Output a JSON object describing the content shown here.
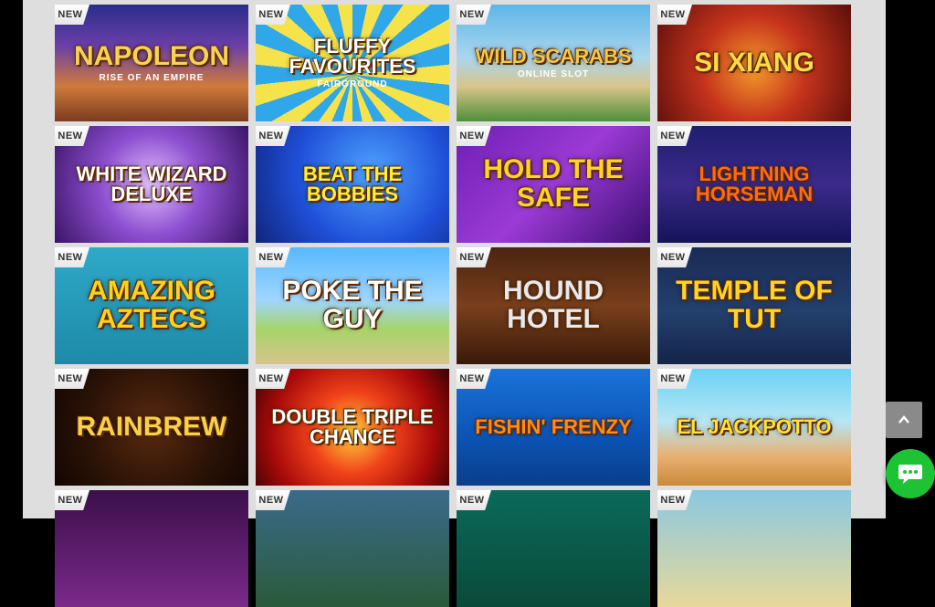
{
  "badge_label": "NEW",
  "colors": {
    "panel": "#dedede",
    "chat_button": "#1ec235",
    "scroll_button": "#8a8a8a"
  },
  "games": [
    {
      "title": "NAPOLEON",
      "subtitle": "RISE OF AN EMPIRE",
      "bg": "linear-gradient(180deg,#2a2d8a 0%,#6a3fa8 35%,#d07a3a 70%,#7a3b1f 100%)",
      "color": "#f7d255",
      "size": "big"
    },
    {
      "title": "Fluffy Favourites",
      "subtitle": "FAIRGROUND",
      "bg": "repeating-conic-gradient(from 0deg at 50% 60%, #2fa7e8 0deg 12deg, #f6e24a 12deg 24deg)",
      "color": "#ffffff",
      "size": "mid"
    },
    {
      "title": "WILD SCARABS",
      "subtitle": "ONLINE SLOT",
      "bg": "linear-gradient(180deg,#5fb5e8 0%,#a9d6ef 45%,#d9c58a 70%,#4e8f3a 100%)",
      "color": "#f2c94c",
      "size": "mid"
    },
    {
      "title": "SI XIANG",
      "subtitle": "",
      "bg": "radial-gradient(circle at 50% 55%,#f59a2b 0%,#c5331c 45%,#5a0e0a 100%)",
      "color": "#ffd94a",
      "size": "big"
    },
    {
      "title": "White Wizard Deluxe",
      "subtitle": "",
      "bg": "radial-gradient(circle at 50% 50%,#e3c2ff 0%,#8e4fd0 45%,#3a1466 100%)",
      "color": "#ffffff",
      "size": "mid"
    },
    {
      "title": "BEAT THE BOBBIES",
      "subtitle": "",
      "bg": "radial-gradient(circle at 60% 40%,#4da3ff 0%,#1f4fd8 55%,#10257a 100%)",
      "color": "#ffef3d",
      "size": "mid"
    },
    {
      "title": "HOLD THE SAFE",
      "subtitle": "",
      "bg": "linear-gradient(135deg,#6e1fb3 0%,#9c3ad6 50%,#3a0e70 100%)",
      "color": "#ffd12b",
      "size": "big"
    },
    {
      "title": "LIGHTNING HORSEMAN",
      "subtitle": "",
      "bg": "linear-gradient(180deg,#1e1e6e 0%,#3c2a8a 50%,#14145a 100%)",
      "color": "#ff6a1a",
      "size": "mid"
    },
    {
      "title": "AMAZING AZTECS",
      "subtitle": "",
      "bg": "linear-gradient(180deg,#2fa9c9 0%,#1d8aa8 100%)",
      "color": "#ffd21f",
      "size": "big"
    },
    {
      "title": "POKE THE GUY",
      "subtitle": "",
      "bg": "linear-gradient(180deg,#58b8ff 0%,#9fd6ff 45%,#a7d46a 70%,#d7c48a 100%)",
      "color": "#ffffff",
      "size": "big"
    },
    {
      "title": "HOUND HOTEL",
      "subtitle": "",
      "bg": "linear-gradient(180deg,#4a2410 0%,#7a3f1c 50%,#3a1a0a 100%)",
      "color": "#e8e8ee",
      "size": "big"
    },
    {
      "title": "TEMPLE OF TUT",
      "subtitle": "",
      "bg": "linear-gradient(180deg,#1a2a55 0%,#23406e 55%,#15244a 100%)",
      "color": "#ffd42a",
      "size": "big"
    },
    {
      "title": "RAINBREW",
      "subtitle": "",
      "bg": "radial-gradient(circle at 50% 50%,#5a2a10 0%,#2a1206 60%,#120602 100%)",
      "color": "#f8d04a",
      "size": "big"
    },
    {
      "title": "Double TRIPLE CHANCE",
      "subtitle": "",
      "bg": "radial-gradient(circle at 50% 55%,#ffd23a 0%,#f0421a 35%,#a80a0a 70%,#3a0202 100%)",
      "color": "#ffffff",
      "size": "mid"
    },
    {
      "title": "FISHIN' FRENZY",
      "subtitle": "",
      "bg": "linear-gradient(180deg,#1a73d8 0%,#0d55b8 55%,#0a3e8a 100%)",
      "color": "#ff8a1a",
      "size": "mid"
    },
    {
      "title": "EL JACKPOTTO",
      "subtitle": "",
      "bg": "linear-gradient(180deg,#6ad2f4 0%,#b6e6f4 45%,#e8b070 75%,#c98a3a 100%)",
      "color": "#ffe23a",
      "size": "mid"
    },
    {
      "title": "",
      "subtitle": "",
      "bg": "linear-gradient(180deg,#3b0f4a 0%,#7a2a8a 100%)",
      "color": "#ffffff",
      "size": "mid"
    },
    {
      "title": "",
      "subtitle": "",
      "bg": "linear-gradient(180deg,#3a6b8a 0%,#2a5a3a 100%)",
      "color": "#ffffff",
      "size": "mid"
    },
    {
      "title": "",
      "subtitle": "",
      "bg": "linear-gradient(180deg,#0a6a5a 0%,#0a4a3a 100%)",
      "color": "#ffffff",
      "size": "mid"
    },
    {
      "title": "",
      "subtitle": "",
      "bg": "linear-gradient(180deg,#8ac8e0 0%,#e8d89a 100%)",
      "color": "#ffffff",
      "size": "mid"
    }
  ]
}
